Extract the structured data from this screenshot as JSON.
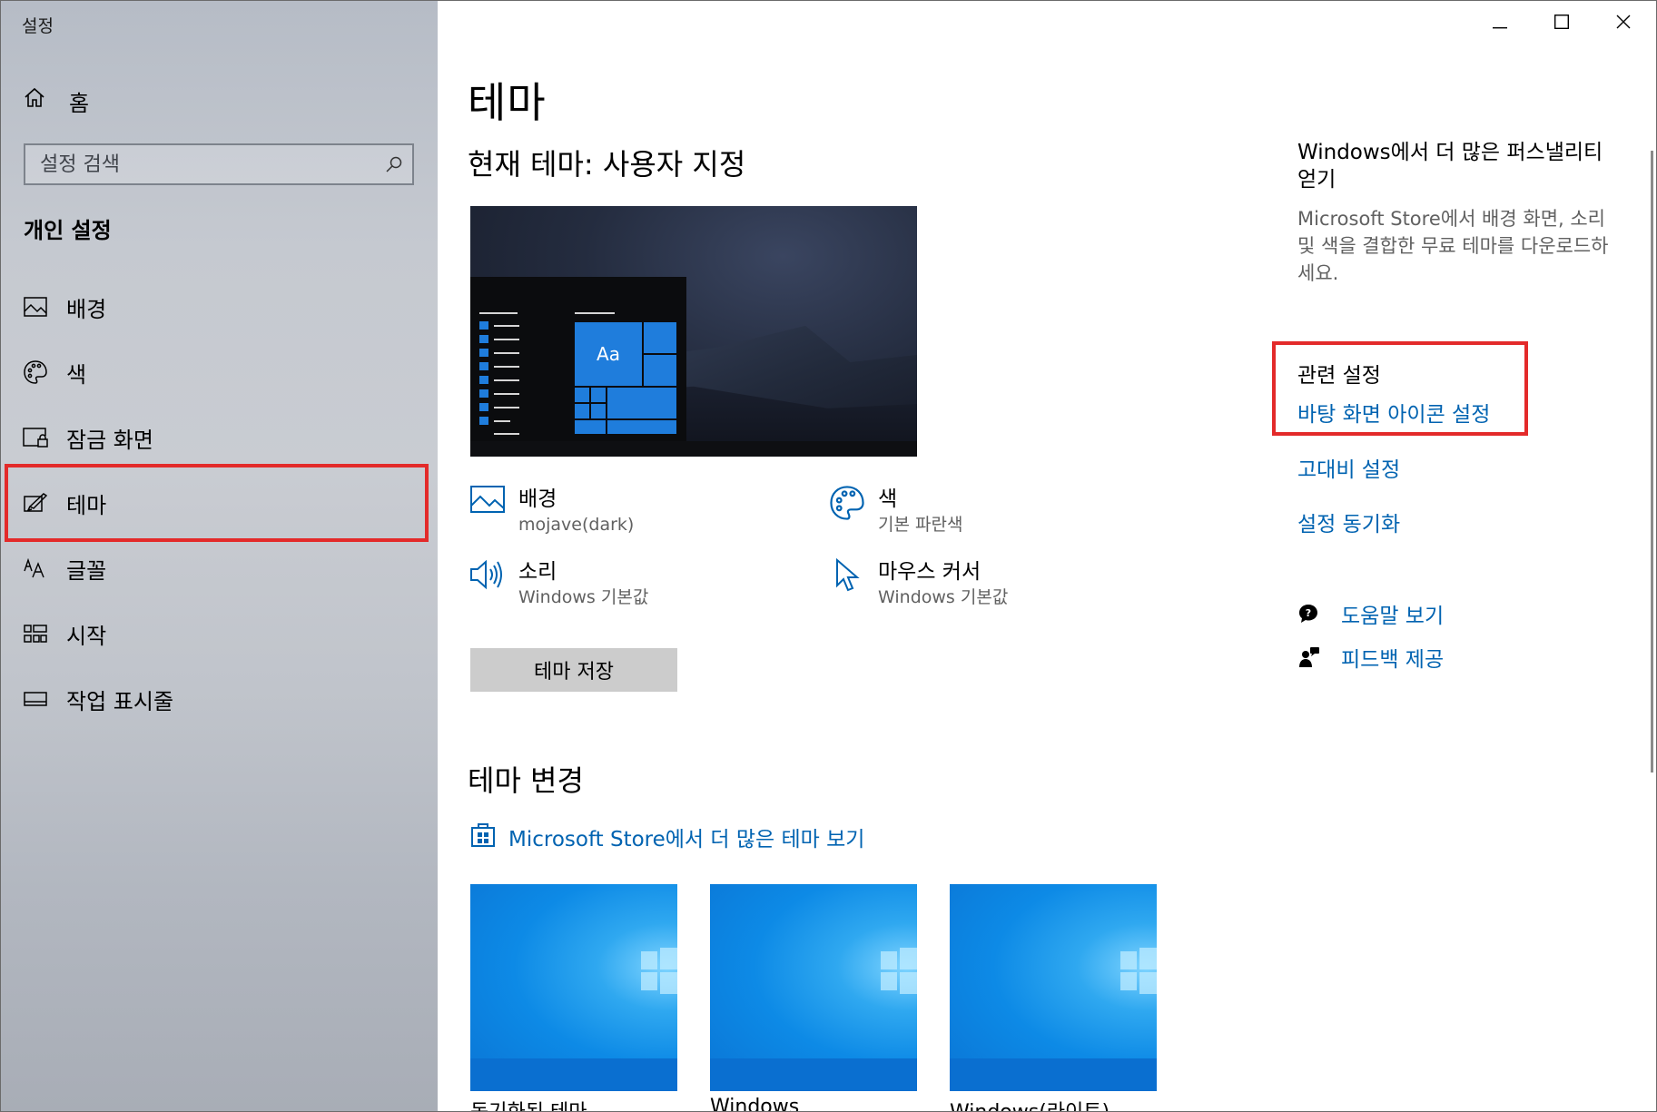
{
  "window": {
    "title": "설정"
  },
  "sidebar": {
    "home_label": "홈",
    "search_placeholder": "설정 검색",
    "section_title": "개인 설정",
    "items": [
      {
        "label": "배경",
        "icon": "image-icon"
      },
      {
        "label": "색",
        "icon": "palette-icon"
      },
      {
        "label": "잠금 화면",
        "icon": "lock-screen-icon"
      },
      {
        "label": "테마",
        "icon": "theme-brush-icon",
        "selected": true
      },
      {
        "label": "글꼴",
        "icon": "font-icon"
      },
      {
        "label": "시작",
        "icon": "start-grid-icon"
      },
      {
        "label": "작업 표시줄",
        "icon": "taskbar-icon"
      }
    ]
  },
  "main": {
    "page_title": "테마",
    "current_theme": "현재 테마: 사용자 지정",
    "preview_tile_text": "Aa",
    "properties": [
      {
        "name": "배경",
        "value": "mojave(dark)",
        "icon": "image-icon"
      },
      {
        "name": "색",
        "value": "기본 파란색",
        "icon": "palette-icon"
      },
      {
        "name": "소리",
        "value": "Windows 기본값",
        "icon": "speaker-icon"
      },
      {
        "name": "마우스 커서",
        "value": "Windows 기본값",
        "icon": "cursor-icon"
      }
    ],
    "save_button": "테마 저장",
    "change_title": "테마 변경",
    "store_link": "Microsoft Store에서 더 많은 테마 보기",
    "themes": [
      {
        "label": "동기화된 테마"
      },
      {
        "label": "Windows"
      },
      {
        "label": "Windows(라이트)"
      }
    ]
  },
  "right_pane": {
    "promo_title": "Windows에서 더 많은 퍼스낼리티 얻기",
    "promo_desc": "Microsoft Store에서 배경 화면, 소리 및 색을 결합한 무료 테마를 다운로드하세요.",
    "related_title": "관련 설정",
    "related_links": [
      "바탕 화면 아이콘 설정",
      "고대비 설정",
      "설정 동기화"
    ],
    "help_links": [
      {
        "label": "도움말 보기",
        "icon": "help-chat-icon"
      },
      {
        "label": "피드백 제공",
        "icon": "feedback-icon"
      }
    ]
  },
  "colors": {
    "accent": "#0063b1",
    "highlight_box": "#e32a2a",
    "tile_blue": "#1f7ddc"
  }
}
